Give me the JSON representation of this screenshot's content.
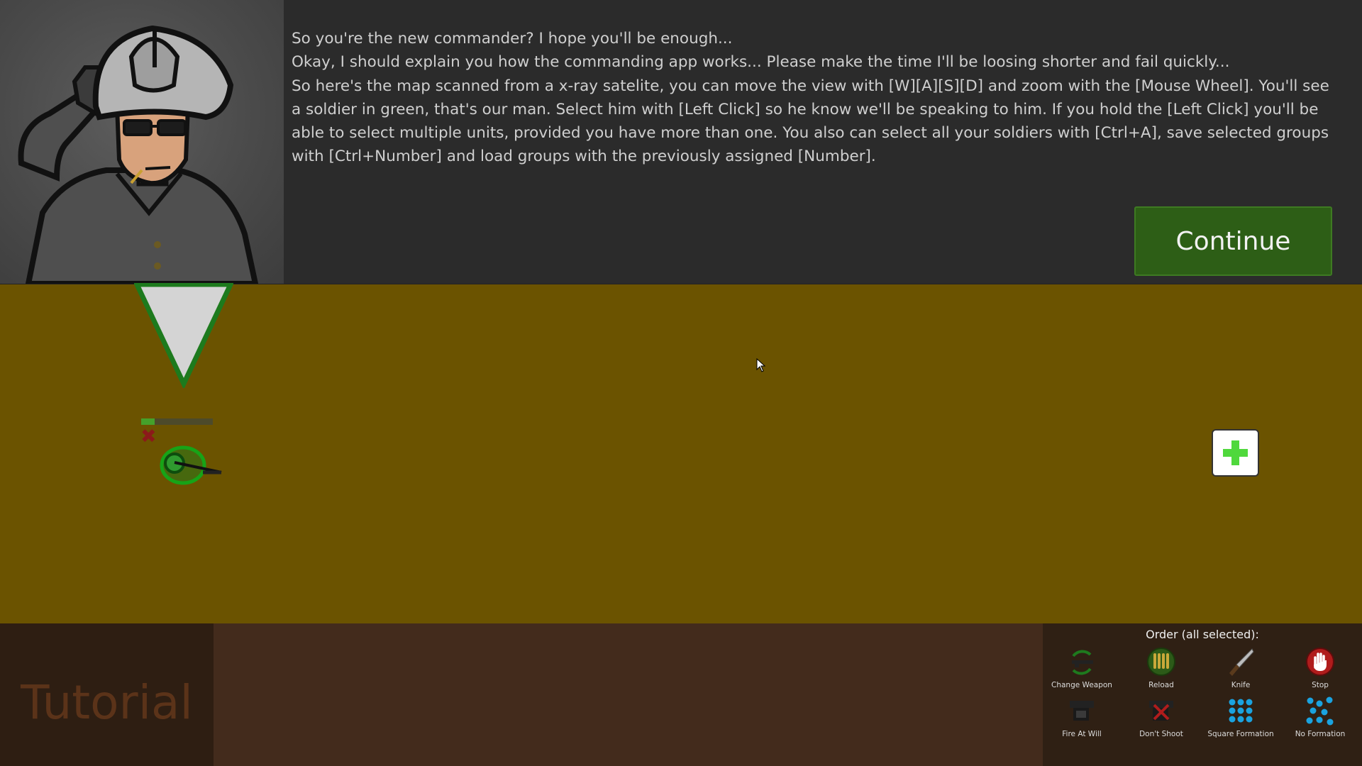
{
  "dialog": {
    "lines": [
      "So you're the new commander? I hope you'll be enough...",
      "Okay, I should explain you how the commanding app works... Please make the time I'll be loosing shorter and fail quickly...",
      "So here's the map scanned from a x-ray satelite, you can move the view with [W][A][S][D] and zoom with the [Mouse Wheel]. You'll see a soldier in green, that's our man. Select him with [Left Click] so he know we'll be speaking to him. If you hold the [Left Click] you'll be able to select multiple units, provided you have more than one. You also can select all your soldiers with [Ctrl+A], save selected groups with [Ctrl+Number] and load groups with the previously assigned [Number]."
    ],
    "continue_label": "Continue"
  },
  "level": {
    "name": "Tutorial"
  },
  "soldier": {
    "health": 0.19
  },
  "orders": {
    "title": "Order (all selected):",
    "buttons": [
      {
        "label": "Change Weapon",
        "icon": "change-weapon-icon"
      },
      {
        "label": "Reload",
        "icon": "reload-icon"
      },
      {
        "label": "Knife",
        "icon": "knife-icon"
      },
      {
        "label": "Stop",
        "icon": "stop-hand-icon"
      },
      {
        "label": "Fire At Will",
        "icon": "fire-at-will-icon"
      },
      {
        "label": "Don't Shoot",
        "icon": "dont-shoot-icon"
      },
      {
        "label": "Square Formation",
        "icon": "square-formation-icon"
      },
      {
        "label": "No Formation",
        "icon": "no-formation-icon"
      }
    ]
  },
  "colors": {
    "ground": "#6b5300",
    "dialog_bg": "#2b2b2b",
    "continue_bg": "#2d5e16",
    "bottom_bar": "#432b1c",
    "tutorial_text": "#5b3319",
    "friendly_green": "#1d7a1d"
  }
}
